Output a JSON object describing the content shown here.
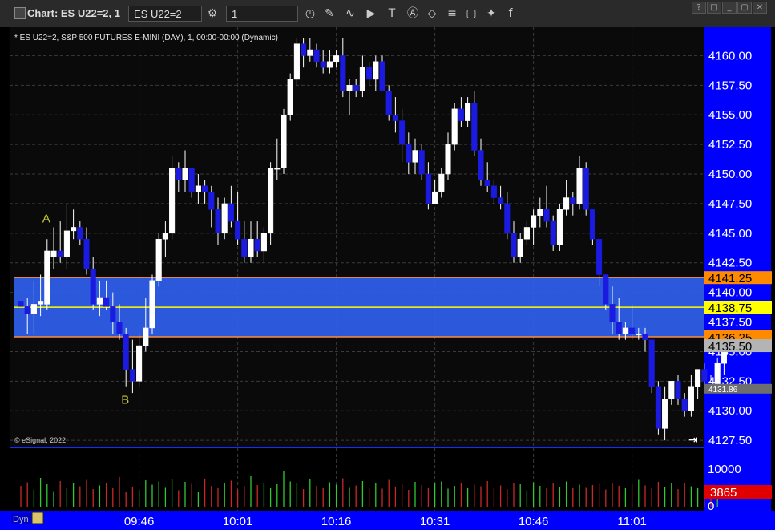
{
  "window": {
    "title": "Chart: ES U22=2, 1",
    "symbol_field": "ES U22=2",
    "interval_field": "1",
    "toolbar_icons": [
      "settings-icon",
      "clock-icon",
      "pencil-icon",
      "wave-icon",
      "play-icon",
      "text-icon",
      "alert-icon",
      "tag-icon",
      "list-icon",
      "comment-icon",
      "twitter-icon",
      "facebook-icon"
    ],
    "window_buttons": [
      "?",
      "□",
      "_",
      "▢",
      "✕"
    ]
  },
  "chart_data": {
    "type": "candlestick",
    "title": "* ES U22=2, S&P 500 FUTURES E-MINI (DAY), 1, 00:00-00:00 (Dynamic)",
    "copyright": "© eSignal, 2022",
    "ylim": [
      4126.9,
      4162.4
    ],
    "y_ticks": [
      "4160.00",
      "4157.50",
      "4155.00",
      "4152.50",
      "4150.00",
      "4147.50",
      "4145.00",
      "4142.50",
      "4140.00",
      "4137.50",
      "4135.00",
      "4132.50",
      "4130.00",
      "4127.50"
    ],
    "x_ticks": [
      "09:46",
      "10:01",
      "10:16",
      "10:31",
      "10:46",
      "11:01"
    ],
    "x_tick_index": [
      18,
      33,
      48,
      63,
      78,
      93
    ],
    "zone": {
      "top": 4141.25,
      "bottom": 4136.25,
      "color": "#2e5ee8",
      "edge": "#ff8a3a"
    },
    "midline": 4138.75,
    "current_price": 4135.5,
    "marker_price": 4131.86,
    "price_tags": [
      {
        "label": "4141.25",
        "value": 4141.25,
        "bg": "#ff8a00",
        "fg": "#000"
      },
      {
        "label": "4138.75",
        "value": 4138.75,
        "bg": "#ffff00",
        "fg": "#000"
      },
      {
        "label": "4136.25",
        "value": 4136.25,
        "bg": "#ff8a00",
        "fg": "#000"
      },
      {
        "label": "4135.50",
        "value": 4135.5,
        "bg": "#b4b4b4",
        "fg": "#000"
      },
      {
        "label": "4131.86",
        "value": 4131.86,
        "bg": "#6e6e6e",
        "fg": "#fff"
      }
    ],
    "annotations": [
      {
        "text": "A",
        "index": 4,
        "price": 4145.9
      },
      {
        "text": "B",
        "index": 16,
        "price": 4130.6
      }
    ],
    "candles": [
      [
        4139.2,
        4139.2,
        4138.8,
        4138.8
      ],
      [
        4138.8,
        4139.5,
        4136.5,
        4138.2
      ],
      [
        4138.2,
        4141.0,
        4136.5,
        4139.0
      ],
      [
        4139.0,
        4141.5,
        4138.0,
        4139.2
      ],
      [
        4139.0,
        4144.5,
        4138.5,
        4143.5
      ],
      [
        4143.0,
        4145.5,
        4142.0,
        4143.5
      ],
      [
        4143.5,
        4146.0,
        4142.5,
        4143.0
      ],
      [
        4143.0,
        4147.5,
        4142.0,
        4145.2
      ],
      [
        4145.2,
        4147.0,
        4144.5,
        4145.5
      ],
      [
        4145.5,
        4146.0,
        4144.0,
        4144.5
      ],
      [
        4144.5,
        4145.5,
        4141.5,
        4142.0
      ],
      [
        4142.0,
        4143.0,
        4138.5,
        4139.0
      ],
      [
        4139.0,
        4141.0,
        4138.0,
        4139.5
      ],
      [
        4139.5,
        4141.0,
        4138.5,
        4138.8
      ],
      [
        4138.8,
        4140.0,
        4136.5,
        4137.5
      ],
      [
        4137.5,
        4139.0,
        4136.0,
        4136.5
      ],
      [
        4136.5,
        4137.0,
        4132.0,
        4133.5
      ],
      [
        4133.5,
        4136.0,
        4131.5,
        4132.5
      ],
      [
        4132.5,
        4136.5,
        4132.0,
        4135.5
      ],
      [
        4135.5,
        4139.5,
        4135.0,
        4137.0
      ],
      [
        4137.0,
        4141.5,
        4136.5,
        4141.0
      ],
      [
        4141.0,
        4145.0,
        4140.5,
        4144.5
      ],
      [
        4144.5,
        4146.0,
        4143.0,
        4145.0
      ],
      [
        4145.0,
        4151.5,
        4144.5,
        4150.5
      ],
      [
        4150.5,
        4151.0,
        4148.5,
        4149.5
      ],
      [
        4149.5,
        4152.0,
        4148.5,
        4150.5
      ],
      [
        4150.5,
        4150.5,
        4148.0,
        4148.5
      ],
      [
        4148.5,
        4150.0,
        4147.5,
        4149.0
      ],
      [
        4149.0,
        4149.5,
        4147.5,
        4148.5
      ],
      [
        4148.5,
        4149.0,
        4145.5,
        4147.0
      ],
      [
        4147.0,
        4148.0,
        4144.0,
        4145.0
      ],
      [
        4145.0,
        4148.0,
        4144.5,
        4147.5
      ],
      [
        4147.5,
        4149.0,
        4145.5,
        4146.0
      ],
      [
        4146.0,
        4148.5,
        4144.0,
        4144.5
      ],
      [
        4144.5,
        4146.0,
        4142.5,
        4143.0
      ],
      [
        4143.0,
        4146.0,
        4142.5,
        4144.5
      ],
      [
        4144.5,
        4146.0,
        4143.0,
        4143.5
      ],
      [
        4143.5,
        4145.5,
        4142.5,
        4145.0
      ],
      [
        4145.0,
        4151.0,
        4144.0,
        4150.5
      ],
      [
        4150.5,
        4153.0,
        4149.5,
        4150.5
      ],
      [
        4150.5,
        4155.5,
        4150.0,
        4155.0
      ],
      [
        4155.0,
        4158.5,
        4154.5,
        4158.0
      ],
      [
        4158.0,
        4161.5,
        4157.5,
        4161.0
      ],
      [
        4161.0,
        4161.5,
        4159.0,
        4160.0
      ],
      [
        4160.0,
        4161.5,
        4159.5,
        4160.5
      ],
      [
        4160.5,
        4161.0,
        4159.0,
        4159.5
      ],
      [
        4159.5,
        4160.5,
        4158.5,
        4159.0
      ],
      [
        4159.0,
        4160.5,
        4158.5,
        4159.5
      ],
      [
        4159.5,
        4160.5,
        4159.0,
        4160.0
      ],
      [
        4160.0,
        4161.5,
        4156.5,
        4157.0
      ],
      [
        4157.0,
        4158.0,
        4155.0,
        4157.5
      ],
      [
        4157.5,
        4158.0,
        4156.5,
        4157.0
      ],
      [
        4157.0,
        4160.0,
        4156.5,
        4159.0
      ],
      [
        4159.0,
        4159.5,
        4157.5,
        4158.0
      ],
      [
        4158.0,
        4160.0,
        4157.0,
        4159.5
      ],
      [
        4159.5,
        4160.0,
        4157.5,
        4157.0
      ],
      [
        4157.0,
        4157.5,
        4154.5,
        4155.0
      ],
      [
        4155.0,
        4156.5,
        4153.5,
        4154.5
      ],
      [
        4154.5,
        4155.5,
        4151.0,
        4152.5
      ],
      [
        4152.5,
        4153.5,
        4150.0,
        4151.0
      ],
      [
        4151.0,
        4153.0,
        4150.0,
        4152.0
      ],
      [
        4152.0,
        4152.5,
        4149.5,
        4150.0
      ],
      [
        4150.0,
        4151.0,
        4147.0,
        4147.5
      ],
      [
        4147.5,
        4149.5,
        4147.5,
        4148.5
      ],
      [
        4148.5,
        4150.5,
        4148.0,
        4150.0
      ],
      [
        4150.0,
        4153.5,
        4149.5,
        4152.5
      ],
      [
        4152.5,
        4156.0,
        4152.0,
        4155.5
      ],
      [
        4155.5,
        4156.5,
        4154.0,
        4154.5
      ],
      [
        4154.5,
        4156.5,
        4154.0,
        4156.0
      ],
      [
        4156.0,
        4157.0,
        4151.5,
        4152.0
      ],
      [
        4152.0,
        4153.0,
        4149.0,
        4149.5
      ],
      [
        4149.5,
        4151.0,
        4148.5,
        4149.0
      ],
      [
        4149.0,
        4149.5,
        4147.5,
        4148.0
      ],
      [
        4148.0,
        4149.0,
        4147.0,
        4147.5
      ],
      [
        4147.5,
        4148.5,
        4144.5,
        4145.0
      ],
      [
        4145.0,
        4146.0,
        4142.5,
        4143.0
      ],
      [
        4143.0,
        4145.0,
        4142.5,
        4144.5
      ],
      [
        4144.5,
        4146.0,
        4144.0,
        4145.5
      ],
      [
        4145.5,
        4147.0,
        4144.0,
        4146.5
      ],
      [
        4146.5,
        4148.0,
        4145.5,
        4147.0
      ],
      [
        4147.0,
        4149.0,
        4145.5,
        4146.0
      ],
      [
        4146.0,
        4146.5,
        4143.5,
        4144.0
      ],
      [
        4144.0,
        4147.5,
        4143.5,
        4147.0
      ],
      [
        4147.0,
        4149.5,
        4146.5,
        4148.0
      ],
      [
        4148.0,
        4148.5,
        4146.5,
        4147.5
      ],
      [
        4147.5,
        4151.5,
        4147.0,
        4150.5
      ],
      [
        4150.5,
        4151.0,
        4146.5,
        4147.0
      ],
      [
        4147.0,
        4147.0,
        4144.0,
        4144.5
      ],
      [
        4144.5,
        4144.5,
        4140.5,
        4141.5
      ],
      [
        4141.5,
        4141.5,
        4138.5,
        4139.0
      ],
      [
        4139.0,
        4140.5,
        4136.5,
        4137.5
      ],
      [
        4137.5,
        4139.5,
        4136.0,
        4136.5
      ],
      [
        4136.5,
        4137.5,
        4136.0,
        4137.0
      ],
      [
        4137.0,
        4139.0,
        4136.0,
        4136.5
      ],
      [
        4136.5,
        4137.0,
        4136.0,
        4136.5
      ],
      [
        4136.5,
        4137.0,
        4135.0,
        4136.0
      ],
      [
        4136.0,
        4136.0,
        4131.5,
        4132.0
      ],
      [
        4132.0,
        4132.5,
        4128.0,
        4128.5
      ],
      [
        4128.5,
        4132.0,
        4127.5,
        4131.0
      ],
      [
        4131.0,
        4132.5,
        4130.5,
        4132.5
      ],
      [
        4132.5,
        4133.0,
        4130.5,
        4131.0
      ],
      [
        4131.0,
        4131.5,
        4129.5,
        4130.0
      ],
      [
        4130.0,
        4133.0,
        4129.5,
        4132.0
      ],
      [
        4132.0,
        4133.5,
        4131.0,
        4133.5
      ],
      [
        4133.5,
        4134.0,
        4132.0,
        4132.5
      ],
      [
        4132.5,
        4133.0,
        4131.5,
        4132.0
      ],
      [
        4132.0,
        4134.5,
        4131.5,
        4134.0
      ],
      [
        4134.0,
        4135.0,
        4133.0,
        4135.5
      ],
      [
        4135.5,
        4136.5,
        4135.0,
        4135.5
      ]
    ],
    "volume": {
      "label_max": "10000",
      "label_min": "0",
      "current": "3865",
      "scale_max": 10000,
      "bars": [
        5200,
        6100,
        4300,
        7200,
        5600,
        3900,
        6400,
        4800,
        5900,
        5100,
        6700,
        4400,
        5300,
        5800,
        4600,
        7400,
        3800,
        5000,
        4200,
        6600,
        5500,
        6300,
        4900,
        7000,
        4100,
        6200,
        5700,
        3800,
        6900,
        5200,
        4700,
        5900,
        6500,
        4300,
        5100,
        7600,
        5400,
        6000,
        4800,
        5600,
        9000,
        6300,
        5900,
        4400,
        6800,
        5200,
        4600,
        6100,
        5500,
        7100,
        4900,
        5300,
        6400,
        4800,
        5800,
        4500,
        6700,
        5000,
        5600,
        4200,
        6200,
        5400,
        4700,
        5800,
        6300,
        4500,
        5200,
        6000,
        4600,
        5500,
        5100,
        6400,
        4800,
        5300,
        4400,
        5900,
        5600,
        4100,
        6100,
        5200,
        4600,
        5800,
        5000,
        6300,
        4700,
        5500,
        4900,
        5400,
        5700,
        4300,
        6000,
        5200,
        4800,
        5600,
        6700,
        5300,
        4600,
        6200,
        5000,
        5800,
        4400,
        5900,
        5100,
        4700,
        5500,
        4200,
        3865
      ],
      "up_color": "#32c832",
      "down_color": "#c82828"
    },
    "bottom_bar": {
      "left_label": "Dyn"
    }
  }
}
